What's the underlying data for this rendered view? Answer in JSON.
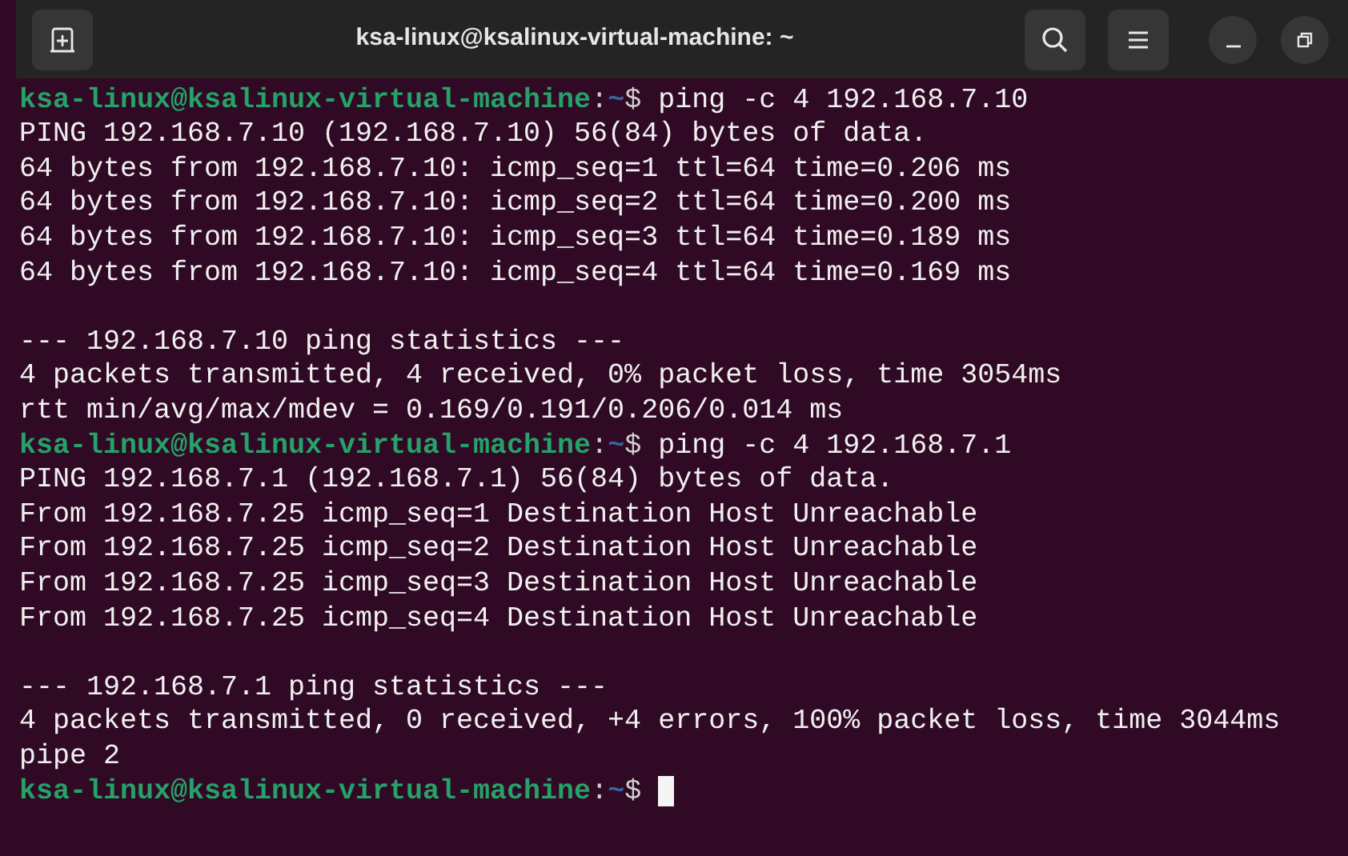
{
  "window": {
    "title": "ksa-linux@ksalinux-virtual-machine: ~"
  },
  "lines": [
    {
      "kind": "prompt",
      "user": "ksa-linux@ksalinux-virtual-machine",
      "separator": ":",
      "path": "~",
      "symbol": "$",
      "command": "ping -c 4 192.168.7.10",
      "cursor": false
    },
    {
      "kind": "output",
      "text": "PING 192.168.7.10 (192.168.7.10) 56(84) bytes of data."
    },
    {
      "kind": "output",
      "text": "64 bytes from 192.168.7.10: icmp_seq=1 ttl=64 time=0.206 ms"
    },
    {
      "kind": "output",
      "text": "64 bytes from 192.168.7.10: icmp_seq=2 ttl=64 time=0.200 ms"
    },
    {
      "kind": "output",
      "text": "64 bytes from 192.168.7.10: icmp_seq=3 ttl=64 time=0.189 ms"
    },
    {
      "kind": "output",
      "text": "64 bytes from 192.168.7.10: icmp_seq=4 ttl=64 time=0.169 ms"
    },
    {
      "kind": "blank"
    },
    {
      "kind": "output",
      "text": "--- 192.168.7.10 ping statistics ---"
    },
    {
      "kind": "output",
      "text": "4 packets transmitted, 4 received, 0% packet loss, time 3054ms"
    },
    {
      "kind": "output",
      "text": "rtt min/avg/max/mdev = 0.169/0.191/0.206/0.014 ms"
    },
    {
      "kind": "prompt",
      "user": "ksa-linux@ksalinux-virtual-machine",
      "separator": ":",
      "path": "~",
      "symbol": "$",
      "command": "ping -c 4 192.168.7.1",
      "cursor": false
    },
    {
      "kind": "output",
      "text": "PING 192.168.7.1 (192.168.7.1) 56(84) bytes of data."
    },
    {
      "kind": "output",
      "text": "From 192.168.7.25 icmp_seq=1 Destination Host Unreachable"
    },
    {
      "kind": "output",
      "text": "From 192.168.7.25 icmp_seq=2 Destination Host Unreachable"
    },
    {
      "kind": "output",
      "text": "From 192.168.7.25 icmp_seq=3 Destination Host Unreachable"
    },
    {
      "kind": "output",
      "text": "From 192.168.7.25 icmp_seq=4 Destination Host Unreachable"
    },
    {
      "kind": "blank"
    },
    {
      "kind": "output",
      "text": "--- 192.168.7.1 ping statistics ---"
    },
    {
      "kind": "output",
      "text": "4 packets transmitted, 0 received, +4 errors, 100% packet loss, time 3044ms"
    },
    {
      "kind": "output",
      "text": "pipe 2"
    },
    {
      "kind": "prompt",
      "user": "ksa-linux@ksalinux-virtual-machine",
      "separator": ":",
      "path": "~",
      "symbol": "$",
      "cursor": true
    }
  ]
}
